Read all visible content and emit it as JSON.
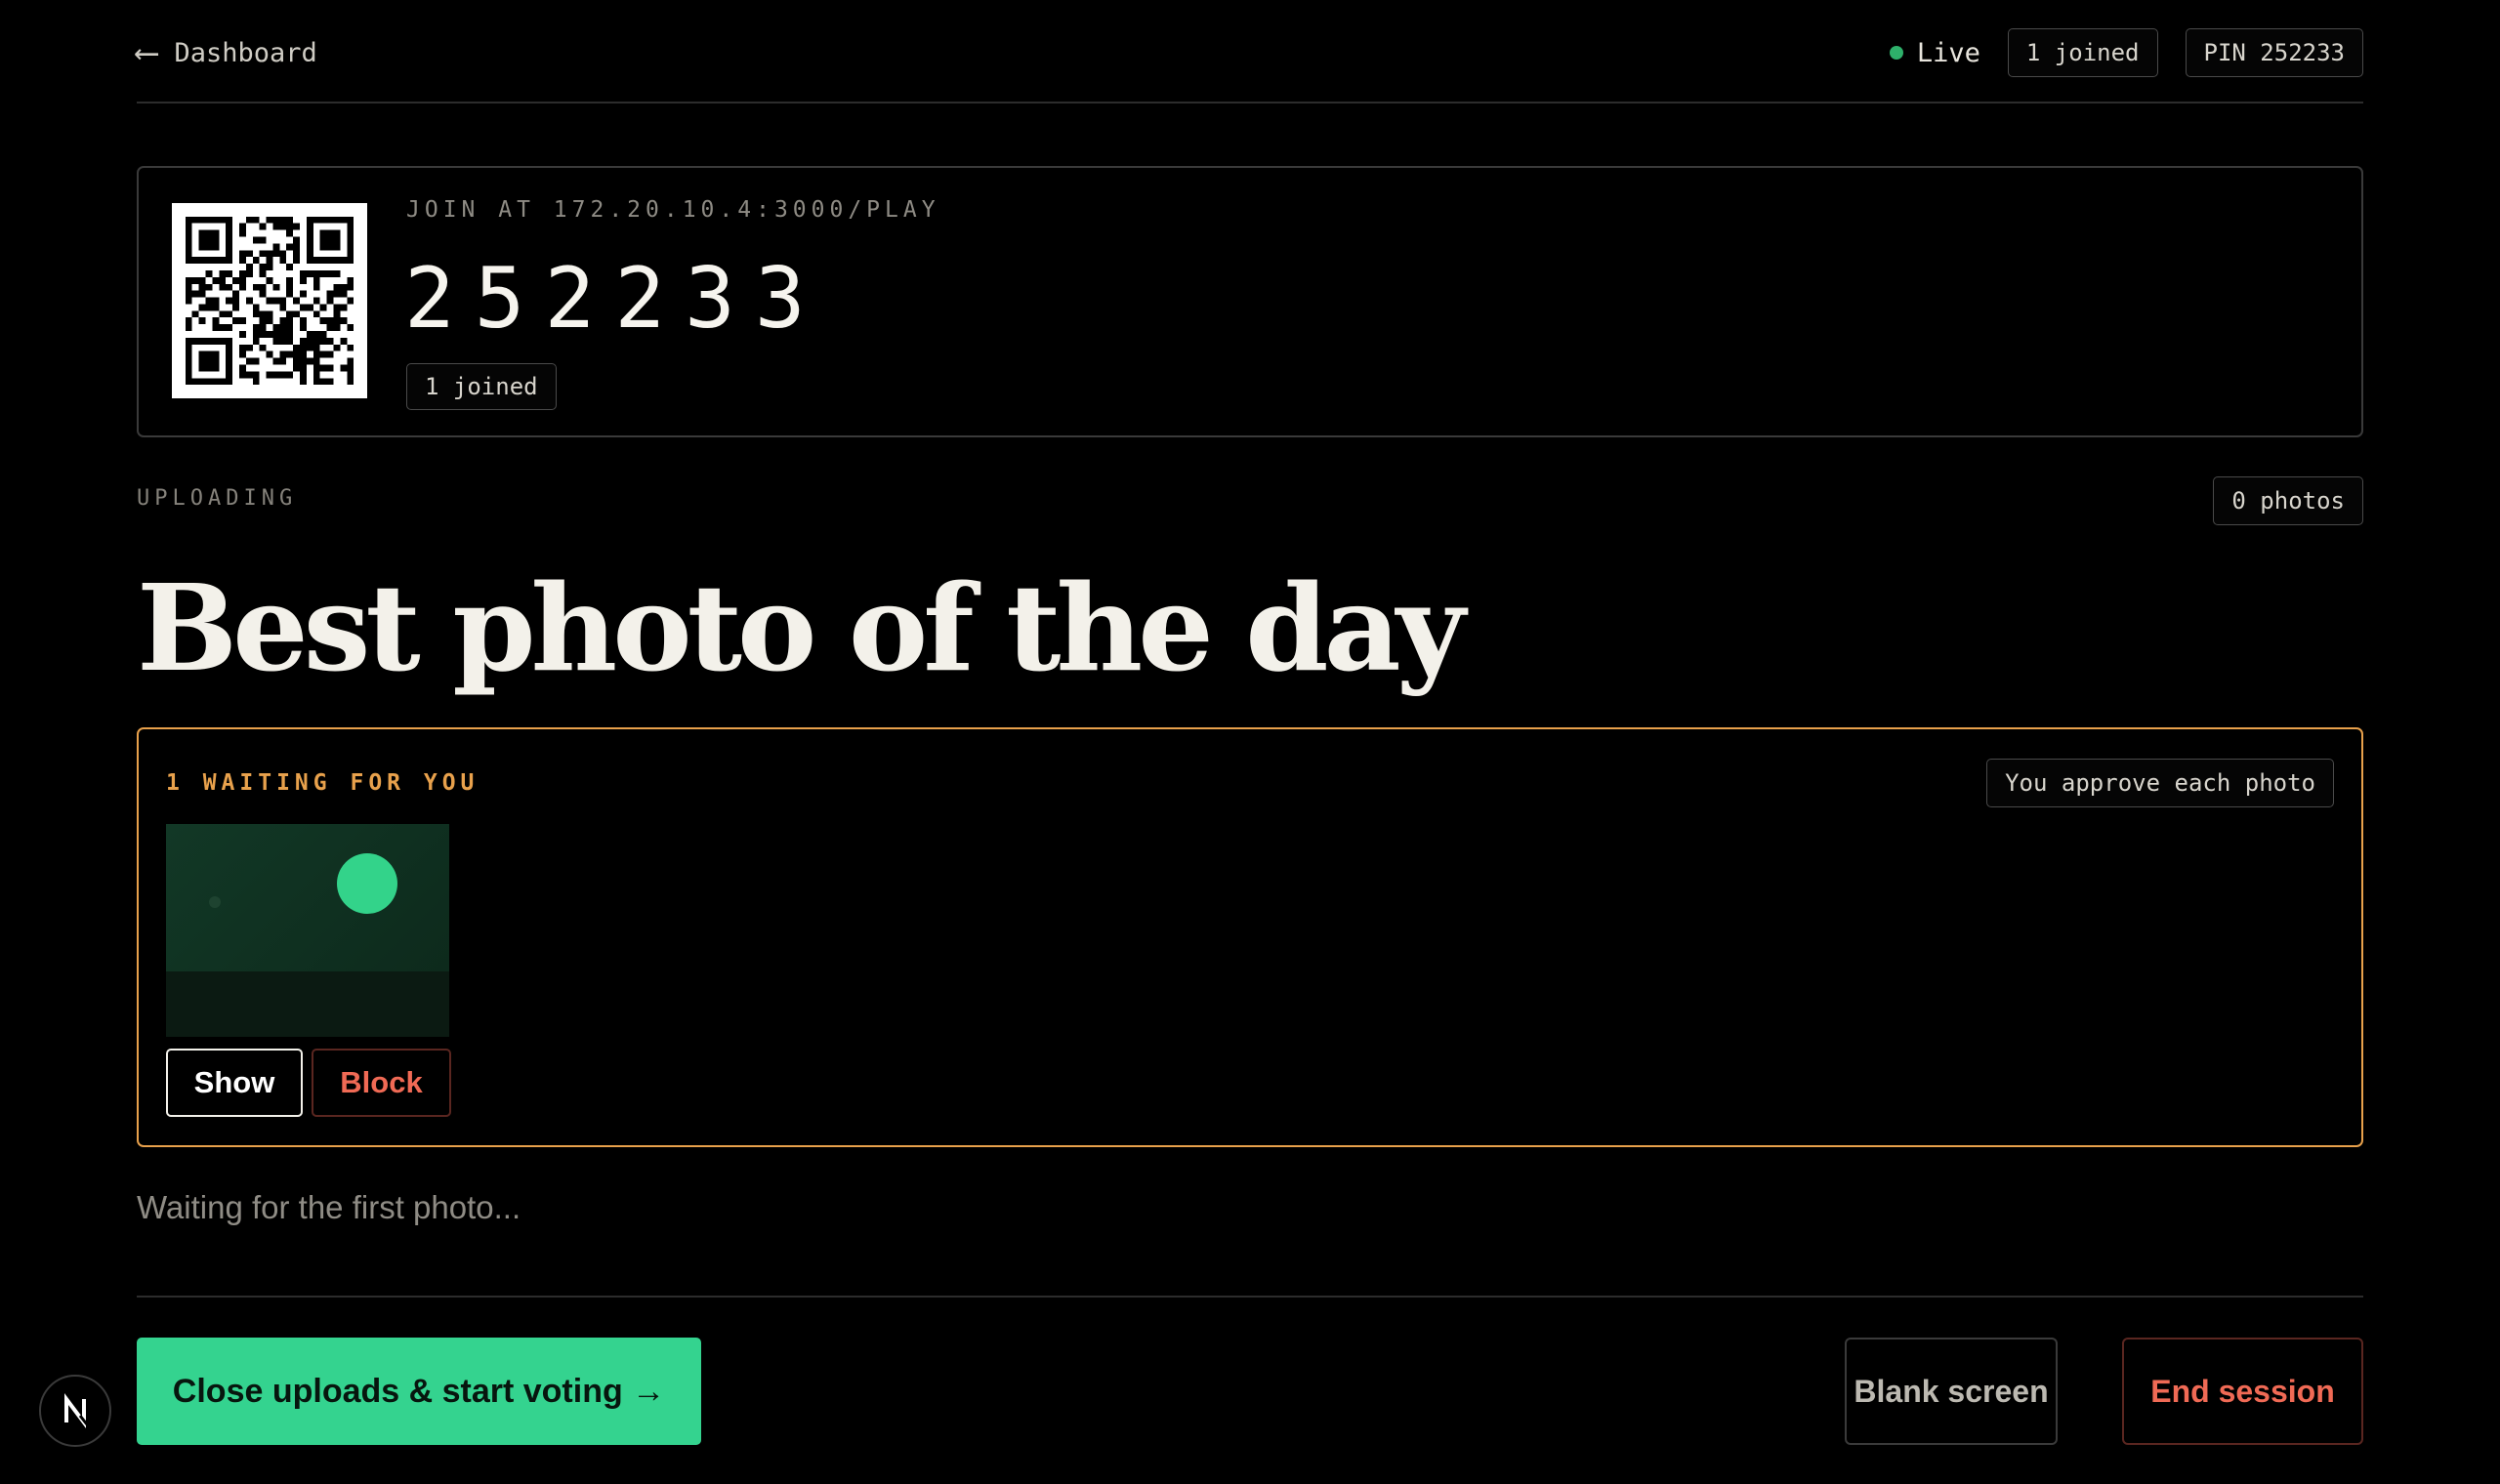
{
  "header": {
    "back_label": "Dashboard",
    "live_label": "Live",
    "joined_chip": "1 joined",
    "pin_chip": "PIN 252233"
  },
  "join": {
    "label": "JOIN AT 172.20.10.4:3000/PLAY",
    "pin": "252233",
    "joined": "1 joined"
  },
  "round": {
    "phase": "UPLOADING",
    "photo_count": "0 photos",
    "title": "Best photo of the day"
  },
  "moderation": {
    "label": "1 WAITING FOR YOU",
    "mode_chip": "You approve each photo",
    "show_label": "Show",
    "block_label": "Block"
  },
  "status": {
    "waiting_text": "Waiting for the first photo..."
  },
  "footer": {
    "primary_label": "Close uploads & start voting →",
    "blank_label": "Blank screen",
    "end_label": "End session"
  },
  "colors": {
    "accent_green": "#34d38f",
    "warning_orange": "#e8a14c",
    "danger_red": "#f06a55",
    "live_dot": "#2eb06a"
  },
  "icons": [
    "arrow-left-icon",
    "live-dot-icon",
    "qr-code-icon",
    "next-badge-icon"
  ]
}
